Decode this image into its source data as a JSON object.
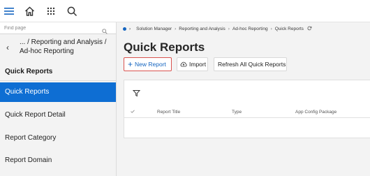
{
  "topbar": {
    "icons": [
      "menu-icon",
      "home-icon",
      "apps-grid-icon",
      "search-icon"
    ]
  },
  "sidebar": {
    "search_placeholder": "Find page",
    "breadcrumb": "... / Reporting and Analysis / Ad-hoc Reporting",
    "section_title": "Quick Reports",
    "items": [
      {
        "label": "Quick Reports",
        "active": true
      },
      {
        "label": "Quick Report Detail",
        "active": false
      },
      {
        "label": "Report Category",
        "active": false
      },
      {
        "label": "Report Domain",
        "active": false
      }
    ]
  },
  "breadcrumb": {
    "items": [
      "Solution Manager",
      "Reporting and Analysis",
      "Ad-hoc Reporting",
      "Quick Reports"
    ]
  },
  "page": {
    "title": "Quick Reports"
  },
  "toolbar": {
    "new_report": "New Report",
    "import": "Import",
    "refresh_all": "Refresh All Quick Reports"
  },
  "table": {
    "columns": [
      "Report Title",
      "Type",
      "App Config Package"
    ]
  },
  "colors": {
    "accent": "#0e6ed3",
    "highlight_border": "#d9534f",
    "sidebar_bg": "#f3f3f3"
  }
}
